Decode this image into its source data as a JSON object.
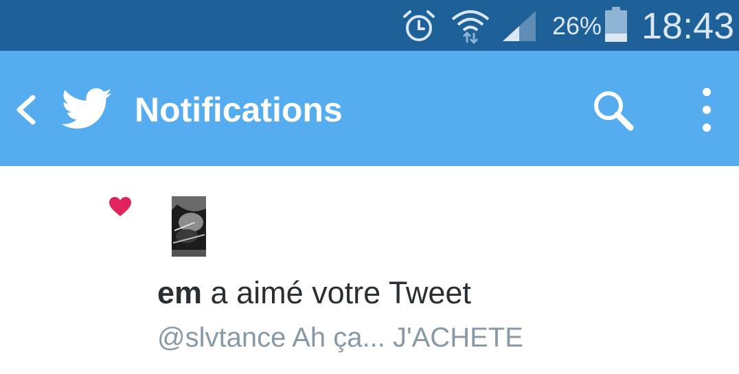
{
  "status_bar": {
    "battery_percent": "26%",
    "battery_level": 0.26,
    "time": "18:43",
    "icons": [
      "alarm-icon",
      "wifi-icon",
      "signal-icon",
      "battery-icon"
    ]
  },
  "app_bar": {
    "title": "Notifications",
    "icons": [
      "back-icon",
      "twitter-logo",
      "search-icon",
      "overflow-menu-icon"
    ]
  },
  "notification": {
    "type_icon": "heart-icon",
    "user": "em",
    "action": " a aimé votre Tweet",
    "tweet_snippet": "@slvtance Ah ça... J'ACHETE"
  },
  "colors": {
    "status_bar": "#1d6198",
    "app_bar": "#55acee",
    "heart": "#e0245e",
    "body_text": "#292f33",
    "secondary_text": "#8899a6"
  }
}
